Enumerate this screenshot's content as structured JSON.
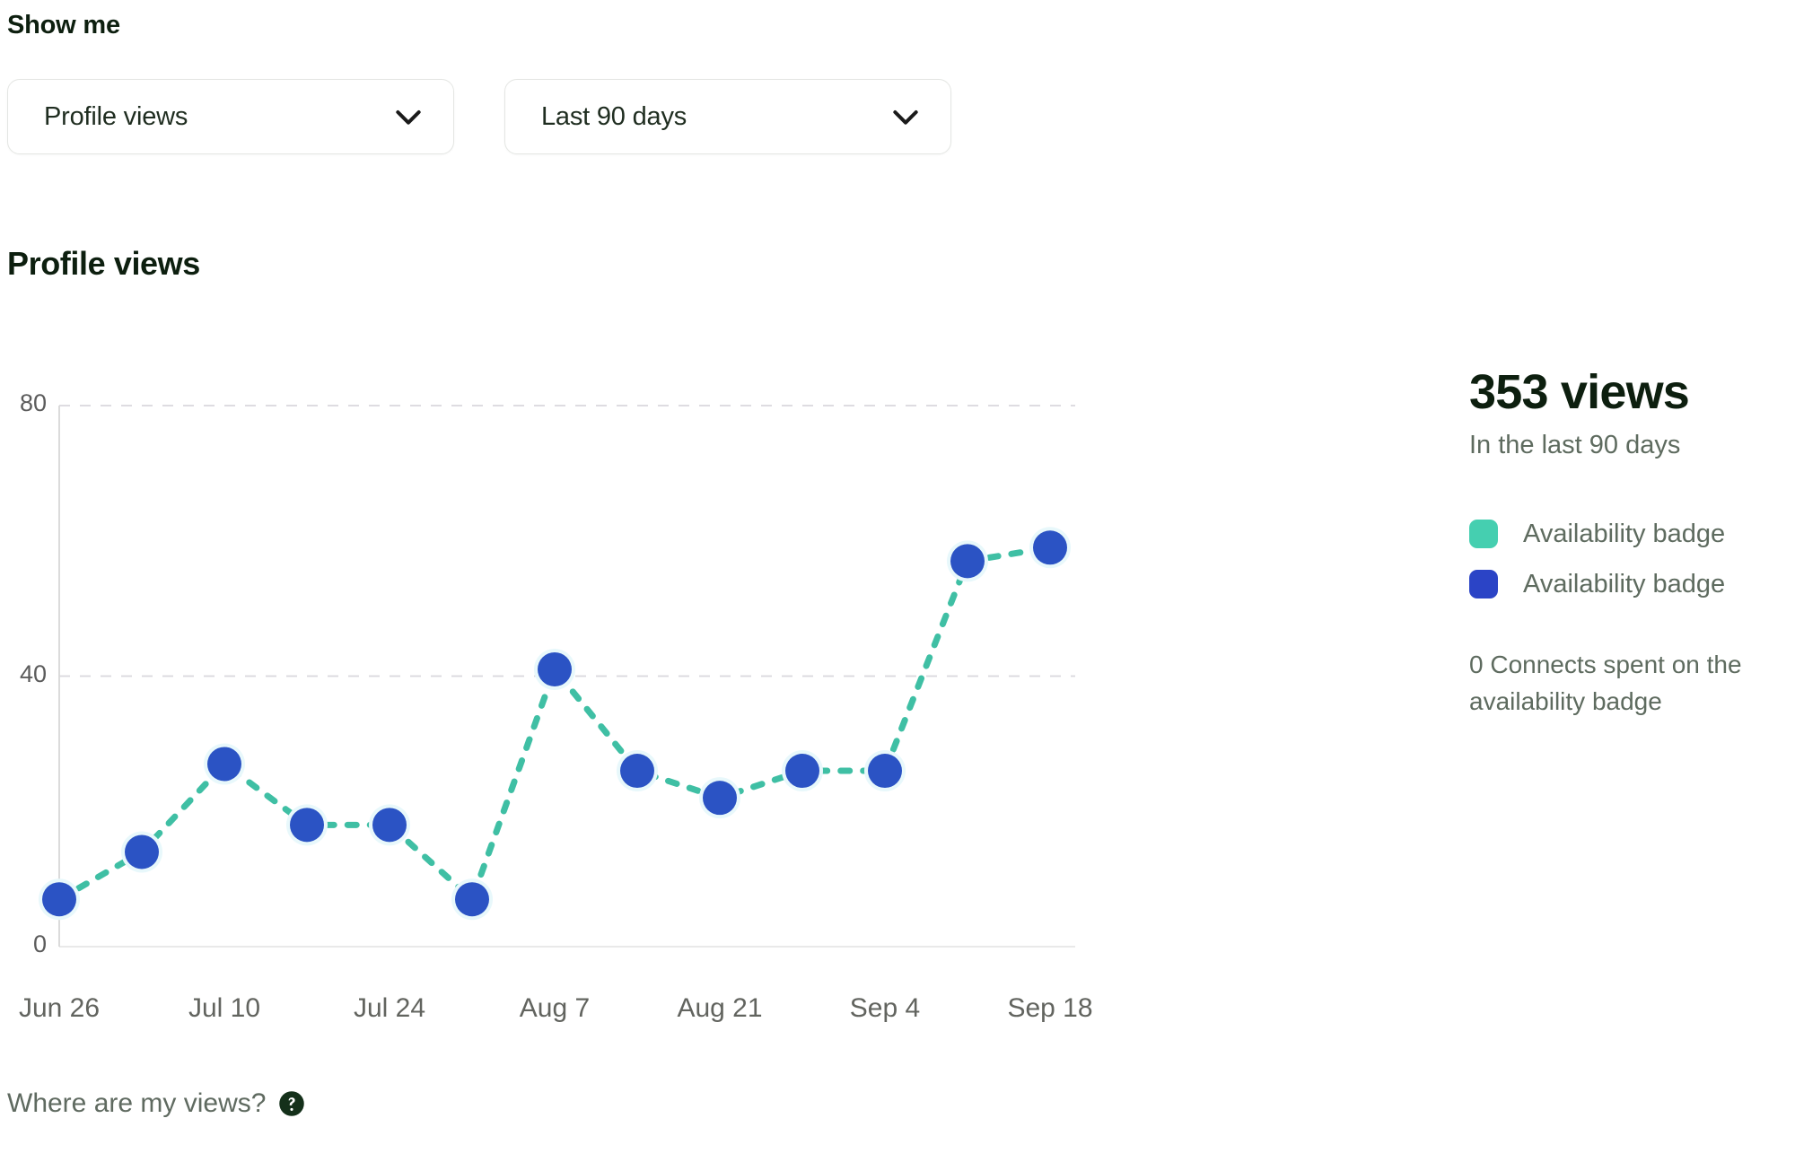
{
  "controls": {
    "show_me_label": "Show me",
    "metric_select": {
      "value": "Profile views",
      "chevron_icon": "chevron-down-icon"
    },
    "range_select": {
      "value": "Last 90 days",
      "chevron_icon": "chevron-down-icon"
    }
  },
  "chart_title": "Profile views",
  "stats": {
    "headline": "353 views",
    "subtitle": "In the last 90 days",
    "legend": [
      {
        "label": "Availability badge",
        "color": "#45cfb0"
      },
      {
        "label": "Availability badge",
        "color": "#2b44c6"
      }
    ],
    "connects_note": "0 Connects spent on the availability badge"
  },
  "footer": {
    "link_text": "Where are my views?",
    "help_icon": "question-mark-circle-icon"
  },
  "chart_data": {
    "type": "line",
    "title": "Profile views",
    "xlabel": "",
    "ylabel": "",
    "ylim": [
      0,
      80
    ],
    "yticks": [
      0,
      40,
      80
    ],
    "grid": true,
    "grid_axis": "y",
    "grid_style": "dashed",
    "legend_position": "right",
    "line_style": "dotted",
    "line_color": "#3fbfa4",
    "marker": "circle",
    "marker_color": "#2b53c4",
    "x": [
      "Jun 26",
      "Jul 3",
      "Jul 10",
      "Jul 17",
      "Jul 24",
      "Jul 31",
      "Aug 7",
      "Aug 14",
      "Aug 21",
      "Aug 28",
      "Sep 4",
      "Sep 11",
      "Sep 18"
    ],
    "xtick_labels": [
      "Jun 26",
      "Jul 10",
      "Jul 24",
      "Aug 7",
      "Aug 21",
      "Sep 4",
      "Sep 18"
    ],
    "series": [
      {
        "name": "Availability badge",
        "values": [
          7,
          14,
          27,
          18,
          18,
          7,
          41,
          26,
          22,
          26,
          26,
          57,
          59
        ]
      }
    ]
  }
}
